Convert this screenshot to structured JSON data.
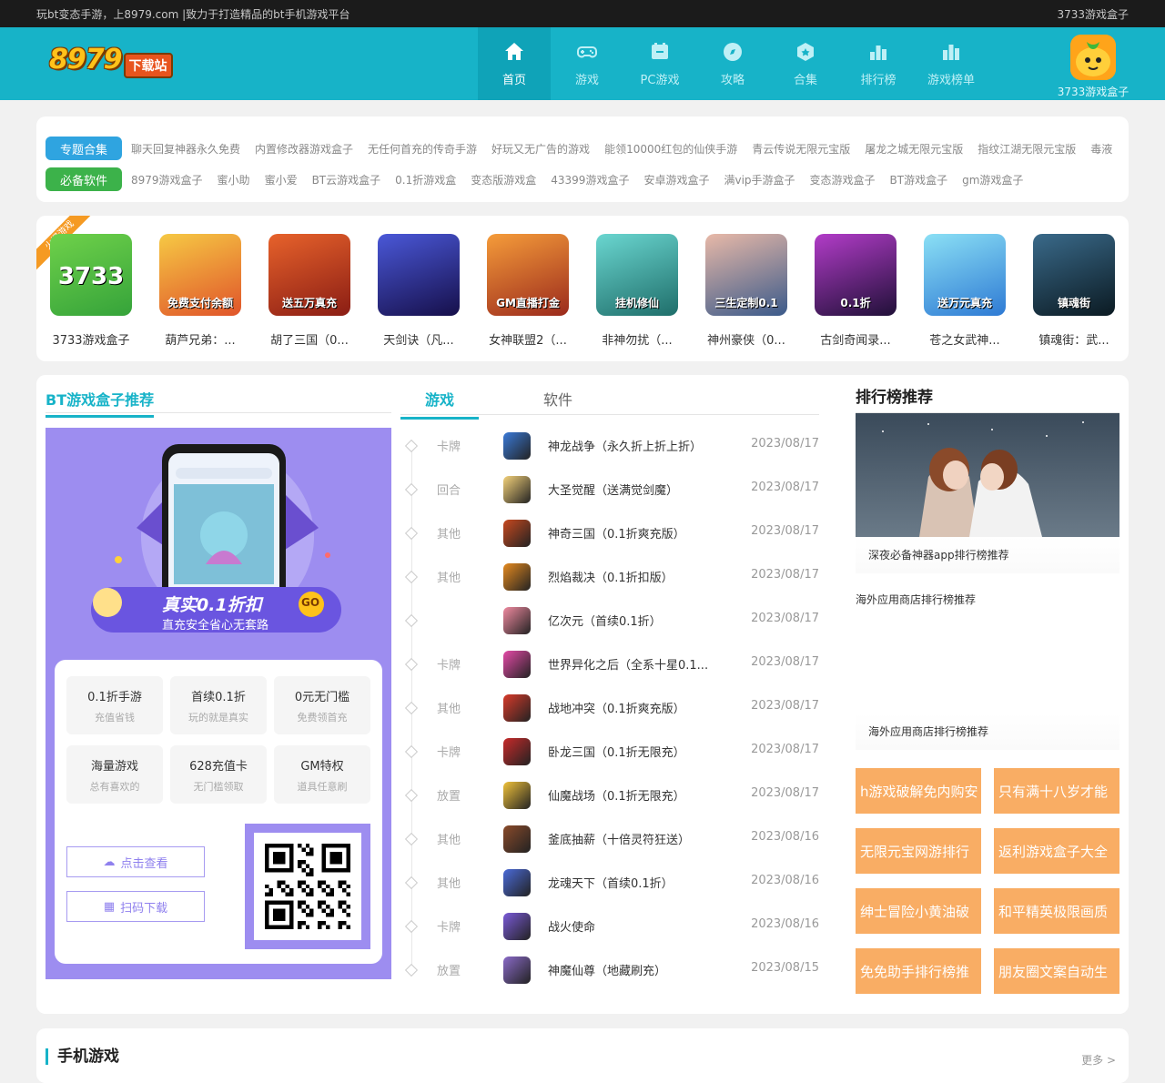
{
  "topbar": {
    "left": "玩bt变态手游，上8979.com |致力于打造精品的bt手机游戏平台",
    "right": "3733游戏盒子"
  },
  "logo": {
    "number": "8979",
    "tag": "下载站"
  },
  "nav": [
    {
      "label": "首页",
      "icon": "home-icon",
      "active": true
    },
    {
      "label": "游戏",
      "icon": "gamepad-icon"
    },
    {
      "label": "PC游戏",
      "icon": "pc-game-icon"
    },
    {
      "label": "攻略",
      "icon": "compass-icon"
    },
    {
      "label": "合集",
      "icon": "collection-icon"
    },
    {
      "label": "排行榜",
      "icon": "rank-icon"
    },
    {
      "label": "游戏榜单",
      "icon": "list-icon"
    }
  ],
  "appbox": {
    "label": "3733游戏盒子"
  },
  "tags": {
    "row1": {
      "head": "专题合集",
      "color": "#2fa4e0",
      "links": [
        "聊天回复神器永久免费",
        "内置修改器游戏盒子",
        "无任何首充的传奇手游",
        "好玩又无广告的游戏",
        "能领10000红包的仙侠手游",
        "青云传说无限元宝版",
        "屠龙之城无限元宝版",
        "指纹江湖无限元宝版",
        "毒液"
      ]
    },
    "row2": {
      "head": "必备软件",
      "color": "#3cb24a",
      "links": [
        "8979游戏盒子",
        "蜜小助",
        "蜜小爱",
        "BT云游戏盒子",
        "0.1折游戏盒",
        "变态版游戏盒",
        "43399游戏盒子",
        "安卓游戏盒子",
        "满vip手游盒子",
        "变态游戏盒子",
        "BT游戏盒子",
        "gm游戏盒子"
      ]
    }
  },
  "games": {
    "ribbon": "火爆游戏",
    "items": [
      {
        "name": "3733游戏盒子",
        "thumb_text": "3733",
        "c1": "#6fd14a",
        "c2": "#35a33a"
      },
      {
        "name": "葫芦兄弟：...",
        "thumb_text": "免费支付余额",
        "c1": "#f6c944",
        "c2": "#e0542a"
      },
      {
        "name": "胡了三国（0...",
        "thumb_text": "送五万真充",
        "c1": "#e7622b",
        "c2": "#8a1d14"
      },
      {
        "name": "天剑诀（凡...",
        "thumb_text": "",
        "c1": "#4a58d8",
        "c2": "#160f4a"
      },
      {
        "name": "女神联盟2（...",
        "thumb_text": "GM直播打金",
        "c1": "#f59c3a",
        "c2": "#9b2a1c"
      },
      {
        "name": "非神勿扰（...",
        "thumb_text": "挂机修仙",
        "c1": "#6ad6d0",
        "c2": "#1f6e6a"
      },
      {
        "name": "神州豪侠（0...",
        "thumb_text": "三生定制0.1",
        "c1": "#e8b9a8",
        "c2": "#3b5a8a"
      },
      {
        "name": "古剑奇闻录...",
        "thumb_text": "0.1折",
        "c1": "#b23cc8",
        "c2": "#201038"
      },
      {
        "name": "苍之女武神...",
        "thumb_text": "送万元真充",
        "c1": "#8be0f5",
        "c2": "#2e7ad4"
      },
      {
        "name": "镇魂街：武...",
        "thumb_text": "镇魂街",
        "c1": "#3a6a8a",
        "c2": "#0b1a22"
      }
    ]
  },
  "bt_box": {
    "title": "BT游戏盒子推荐",
    "banner_main": "真实0.1折扣",
    "banner_sub": "直充安全省心无套路",
    "features": [
      {
        "t": "0.1折手游",
        "s": "充值省钱"
      },
      {
        "t": "首续0.1折",
        "s": "玩的就是真实"
      },
      {
        "t": "0元无门槛",
        "s": "免费领首充"
      },
      {
        "t": "海量游戏",
        "s": "总有喜欢的"
      },
      {
        "t": "628充值卡",
        "s": "无门槛领取"
      },
      {
        "t": "GM特权",
        "s": "道具任意刷"
      }
    ],
    "btn_view": "点击查看",
    "btn_scan": "扫码下载"
  },
  "list_tabs": {
    "active": "游戏",
    "other": "软件"
  },
  "game_list": [
    {
      "cat": "卡牌",
      "name": "神龙战争（永久折上折上折）",
      "date": "2023/08/17",
      "color": "#3a7ad8"
    },
    {
      "cat": "回合",
      "name": "大圣觉醒（送满觉剑魔）",
      "date": "2023/08/17",
      "color": "#f4d27a"
    },
    {
      "cat": "其他",
      "name": "神奇三国（0.1折爽充版）",
      "date": "2023/08/17",
      "color": "#c8491f"
    },
    {
      "cat": "其他",
      "name": "烈焰裁决（0.1折扣版）",
      "date": "2023/08/17",
      "color": "#e58a1f"
    },
    {
      "cat": "",
      "name": "亿次元（首续0.1折）",
      "date": "2023/08/17",
      "color": "#f08aa0"
    },
    {
      "cat": "卡牌",
      "name": "世界异化之后（全系十星0.1...",
      "date": "2023/08/17",
      "color": "#e54aa8"
    },
    {
      "cat": "其他",
      "name": "战地冲突（0.1折爽充版）",
      "date": "2023/08/17",
      "color": "#d83a2a"
    },
    {
      "cat": "卡牌",
      "name": "卧龙三国（0.1折无限充）",
      "date": "2023/08/17",
      "color": "#c82a2a"
    },
    {
      "cat": "放置",
      "name": "仙魔战场（0.1折无限充）",
      "date": "2023/08/17",
      "color": "#f0c23a"
    },
    {
      "cat": "其他",
      "name": "釜底抽薪（十倍灵符狂送）",
      "date": "2023/08/16",
      "color": "#8a4a2a"
    },
    {
      "cat": "其他",
      "name": "龙魂天下（首续0.1折）",
      "date": "2023/08/16",
      "color": "#4a6ad8"
    },
    {
      "cat": "卡牌",
      "name": "战火使命",
      "date": "2023/08/16",
      "color": "#7a5ad8"
    },
    {
      "cat": "放置",
      "name": "神魔仙尊（地藏刷充）",
      "date": "2023/08/15",
      "color": "#8a6ac8"
    }
  ],
  "rank": {
    "title": "排行榜推荐",
    "cap1": "深夜必备神器app排行榜推荐",
    "cap2": "海外应用商店排行榜推荐",
    "cap3": "海外应用商店排行榜推荐",
    "tags": [
      "h游戏破解免内购安",
      "只有满十八岁才能",
      "无限元宝网游排行",
      "返利游戏盒子大全",
      "绅士冒险小黄油破",
      "和平精英极限画质",
      "免免助手排行榜推",
      "朋友圈文案自动生"
    ]
  },
  "bottom": {
    "title": "手机游戏",
    "more": "更多 >"
  }
}
